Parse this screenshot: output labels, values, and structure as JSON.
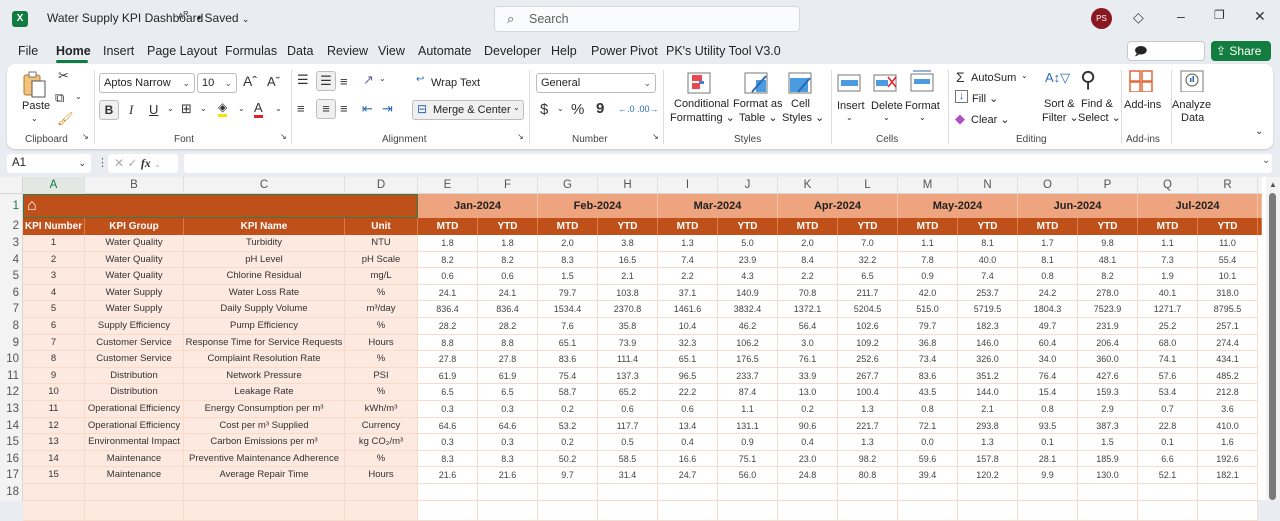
{
  "titlebar": {
    "app_icon": "excel-logo-icon",
    "document_title": "Water Supply KPI Dashboard",
    "status": "• Saved",
    "search_placeholder": "Search",
    "avatar_initials": "PS"
  },
  "menu": {
    "tabs": [
      "File",
      "Home",
      "Insert",
      "Page Layout",
      "Formulas",
      "Data",
      "Review",
      "View",
      "Automate",
      "Developer",
      "Help",
      "Power Pivot",
      "PK's Utility Tool V3.0"
    ],
    "active_tab": "Home",
    "comments_label": "Comments",
    "share_label": "Share"
  },
  "ribbon": {
    "clipboard": {
      "label": "Clipboard",
      "paste": "Paste"
    },
    "font": {
      "label": "Font",
      "font_name": "Aptos Narrow",
      "font_size": "10",
      "bold": "B",
      "italic": "I",
      "underline": "U"
    },
    "alignment": {
      "label": "Alignment",
      "wrap_text": "Wrap Text",
      "merge_center": "Merge & Center"
    },
    "number": {
      "label": "Number",
      "format": "General",
      "currency": "$",
      "percent": "%",
      "comma": "9"
    },
    "styles": {
      "label": "Styles",
      "conditional_formatting": [
        "Conditional",
        "Formatting"
      ],
      "format_as_table": [
        "Format as",
        "Table"
      ],
      "cell_styles": [
        "Cell",
        "Styles"
      ]
    },
    "cells": {
      "label": "Cells",
      "insert": "Insert",
      "delete": "Delete",
      "format": "Format"
    },
    "editing": {
      "label": "Editing",
      "autosum": "AutoSum",
      "fill": "Fill",
      "clear": "Clear",
      "sort_filter": [
        "Sort &",
        "Filter"
      ],
      "find_select": [
        "Find &",
        "Select"
      ]
    },
    "addins": {
      "label": "Add-ins",
      "addins": "Add-ins"
    },
    "analyze": {
      "analyze_data": [
        "Analyze",
        "Data"
      ]
    }
  },
  "formula_bar": {
    "name_box": "A1",
    "formula": "",
    "fx": "fx"
  },
  "sheet": {
    "columns": [
      "A",
      "B",
      "C",
      "D",
      "E",
      "F",
      "G",
      "H",
      "I",
      "J",
      "K",
      "L",
      "M",
      "N",
      "O",
      "P",
      "Q",
      "R"
    ],
    "selected_cell": "A1",
    "meta_headers": [
      "KPI Number",
      "KPI Group",
      "KPI Name",
      "Unit"
    ],
    "months": [
      "Jan-2024",
      "Feb-2024",
      "Mar-2024",
      "Apr-2024",
      "May-2024",
      "Jun-2024",
      "Jul-2024"
    ],
    "sub_headers": [
      "MTD",
      "YTD"
    ],
    "row_numbers": [
      "1",
      "2",
      "3",
      "4",
      "5",
      "6",
      "7",
      "8",
      "9",
      "10",
      "11",
      "12",
      "13",
      "14",
      "15",
      "16",
      "17",
      "18"
    ],
    "header_colors": {
      "dark": "#c0501a",
      "light": "#eea47e",
      "meta_fill": "#fde9df"
    },
    "rows": [
      {
        "num": "1",
        "group": "Water Quality",
        "name": "Turbidity",
        "unit": "NTU",
        "values": [
          "1.8",
          "1.8",
          "2.0",
          "3.8",
          "1.3",
          "5.0",
          "2.0",
          "7.0",
          "1.1",
          "8.1",
          "1.7",
          "9.8",
          "1.1",
          "11.0"
        ]
      },
      {
        "num": "2",
        "group": "Water Quality",
        "name": "pH Level",
        "unit": "pH Scale",
        "values": [
          "8.2",
          "8.2",
          "8.3",
          "16.5",
          "7.4",
          "23.9",
          "8.4",
          "32.2",
          "7.8",
          "40.0",
          "8.1",
          "48.1",
          "7.3",
          "55.4"
        ]
      },
      {
        "num": "3",
        "group": "Water Quality",
        "name": "Chlorine Residual",
        "unit": "mg/L",
        "values": [
          "0.6",
          "0.6",
          "1.5",
          "2.1",
          "2.2",
          "4.3",
          "2.2",
          "6.5",
          "0.9",
          "7.4",
          "0.8",
          "8.2",
          "1.9",
          "10.1"
        ]
      },
      {
        "num": "4",
        "group": "Water Supply",
        "name": "Water Loss Rate",
        "unit": "%",
        "values": [
          "24.1",
          "24.1",
          "79.7",
          "103.8",
          "37.1",
          "140.9",
          "70.8",
          "211.7",
          "42.0",
          "253.7",
          "24.2",
          "278.0",
          "40.1",
          "318.0"
        ]
      },
      {
        "num": "5",
        "group": "Water Supply",
        "name": "Daily Supply Volume",
        "unit": "m³/day",
        "values": [
          "836.4",
          "836.4",
          "1534.4",
          "2370.8",
          "1461.6",
          "3832.4",
          "1372.1",
          "5204.5",
          "515.0",
          "5719.5",
          "1804.3",
          "7523.9",
          "1271.7",
          "8795.5"
        ]
      },
      {
        "num": "6",
        "group": "Supply Efficiency",
        "name": "Pump Efficiency",
        "unit": "%",
        "values": [
          "28.2",
          "28.2",
          "7.6",
          "35.8",
          "10.4",
          "46.2",
          "56.4",
          "102.6",
          "79.7",
          "182.3",
          "49.7",
          "231.9",
          "25.2",
          "257.1"
        ]
      },
      {
        "num": "7",
        "group": "Customer Service",
        "name": "Response Time for Service Requests",
        "unit": "Hours",
        "values": [
          "8.8",
          "8.8",
          "65.1",
          "73.9",
          "32.3",
          "106.2",
          "3.0",
          "109.2",
          "36.8",
          "146.0",
          "60.4",
          "206.4",
          "68.0",
          "274.4"
        ]
      },
      {
        "num": "8",
        "group": "Customer Service",
        "name": "Complaint Resolution Rate",
        "unit": "%",
        "values": [
          "27.8",
          "27.8",
          "83.6",
          "111.4",
          "65.1",
          "176.5",
          "76.1",
          "252.6",
          "73.4",
          "326.0",
          "34.0",
          "360.0",
          "74.1",
          "434.1"
        ]
      },
      {
        "num": "9",
        "group": "Distribution",
        "name": "Network Pressure",
        "unit": "PSI",
        "values": [
          "61.9",
          "61.9",
          "75.4",
          "137.3",
          "96.5",
          "233.7",
          "33.9",
          "267.7",
          "83.6",
          "351.2",
          "76.4",
          "427.6",
          "57.6",
          "485.2"
        ]
      },
      {
        "num": "10",
        "group": "Distribution",
        "name": "Leakage Rate",
        "unit": "%",
        "values": [
          "6.5",
          "6.5",
          "58.7",
          "65.2",
          "22.2",
          "87.4",
          "13.0",
          "100.4",
          "43.5",
          "144.0",
          "15.4",
          "159.3",
          "53.4",
          "212.8"
        ]
      },
      {
        "num": "11",
        "group": "Operational Efficiency",
        "name": "Energy Consumption per m³",
        "unit": "kWh/m³",
        "values": [
          "0.3",
          "0.3",
          "0.2",
          "0.6",
          "0.6",
          "1.1",
          "0.2",
          "1.3",
          "0.8",
          "2.1",
          "0.8",
          "2.9",
          "0.7",
          "3.6"
        ]
      },
      {
        "num": "12",
        "group": "Operational Efficiency",
        "name": "Cost per m³ Supplied",
        "unit": "Currency",
        "values": [
          "64.6",
          "64.6",
          "53.2",
          "117.7",
          "13.4",
          "131.1",
          "90.6",
          "221.7",
          "72.1",
          "293.8",
          "93.5",
          "387.3",
          "22.8",
          "410.0"
        ]
      },
      {
        "num": "13",
        "group": "Environmental Impact",
        "name": "Carbon Emissions per m³",
        "unit": "kg CO₂/m³",
        "values": [
          "0.3",
          "0.3",
          "0.2",
          "0.5",
          "0.4",
          "0.9",
          "0.4",
          "1.3",
          "0.0",
          "1.3",
          "0.1",
          "1.5",
          "0.1",
          "1.6"
        ]
      },
      {
        "num": "14",
        "group": "Maintenance",
        "name": "Preventive Maintenance Adherence",
        "unit": "%",
        "values": [
          "8.3",
          "8.3",
          "50.2",
          "58.5",
          "16.6",
          "75.1",
          "23.0",
          "98.2",
          "59.6",
          "157.8",
          "28.1",
          "185.9",
          "6.6",
          "192.6"
        ]
      },
      {
        "num": "15",
        "group": "Maintenance",
        "name": "Average Repair Time",
        "unit": "Hours",
        "values": [
          "21.6",
          "21.6",
          "9.7",
          "31.4",
          "24.7",
          "56.0",
          "24.8",
          "80.8",
          "39.4",
          "120.2",
          "9.9",
          "130.0",
          "52.1",
          "182.1"
        ]
      }
    ]
  }
}
